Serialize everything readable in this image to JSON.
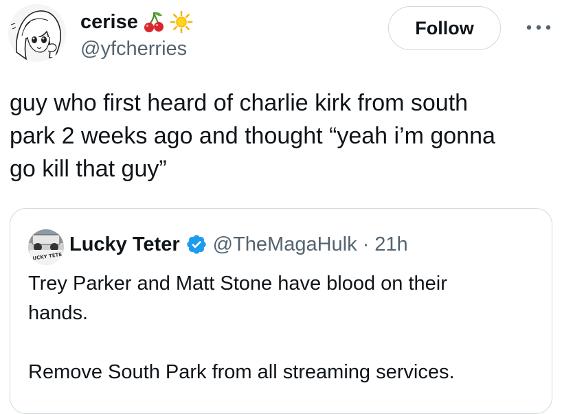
{
  "author": {
    "display_name": "cerise",
    "handle": "@yfcherries",
    "emoji": [
      "cherry-emoji",
      "sun-emoji"
    ]
  },
  "actions": {
    "follow_label": "Follow",
    "more_icon": "more-horizontal-icon"
  },
  "tweet": {
    "text": "guy who first heard of charlie kirk from south\npark 2 weeks ago and thought “yeah i’m gonna\ngo kill that guy”"
  },
  "quote": {
    "display_name": "Lucky Teter",
    "verified": true,
    "handle": "@TheMagaHulk",
    "separator": "·",
    "time": "21h",
    "text": "Trey Parker and Matt Stone have blood on their\nhands.\n\nRemove South Park from all streaming services.",
    "avatar_text": "LUCKY TETE"
  },
  "colors": {
    "text_primary": "#0f1419",
    "text_secondary": "#536471",
    "border": "#cfd9de",
    "verified_blue": "#1d9bf0",
    "cherry_red": "#d8262c",
    "sun_yellow": "#f7b500"
  }
}
